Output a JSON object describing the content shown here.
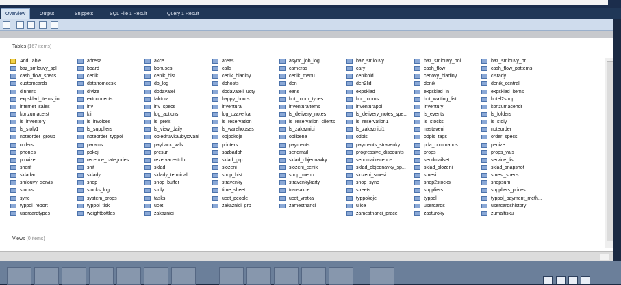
{
  "tabs": [
    {
      "label": "Overview",
      "active": true
    },
    {
      "label": "Output"
    },
    {
      "label": "Snippets"
    },
    {
      "label": "SQL File 1 Result"
    },
    {
      "label": "Query 1 Result"
    }
  ],
  "tables": {
    "title": "Tables",
    "count": "(167 items)",
    "add_label": "Add Table",
    "columns": [
      [
        "baz_smlouvy_spl",
        "cash_flow_specs",
        "customcards",
        "dinners",
        "expsklad_items_in",
        "internet_sales",
        "konzumacelst",
        "ls_inventory",
        "ls_stoly1",
        "noteorder_group",
        "orders",
        "phones",
        "provize",
        "sherif",
        "skladan",
        "smlouvy_servis",
        "stocks",
        "sync",
        "typpol_report",
        "usercardtypes"
      ],
      [
        "adresa",
        "board",
        "cenik",
        "datafromcesk",
        "divize",
        "extconnects",
        "inv",
        "kli",
        "ls_invoices",
        "ls_suppliers",
        "noteorder_typpol",
        "params",
        "pokoj",
        "recepce_categories",
        "shit",
        "sklady",
        "snop",
        "stocks_log",
        "system_props",
        "typpol_tisk",
        "weightbottles"
      ],
      [
        "akce",
        "bonuses",
        "cenik_hist",
        "db_log",
        "dodavatel",
        "faktura",
        "inv_specs",
        "log_actions",
        "ls_prefs",
        "ls_view_daily",
        "objednavkaubytovani",
        "payback_vals",
        "presun",
        "rezervacestolu",
        "sklad",
        "sklady_terminal",
        "snop_buffer",
        "stoly",
        "tasks",
        "ucet",
        "zakaznici"
      ],
      [
        "areas",
        "calls",
        "cenik_hladiny",
        "dbhosts",
        "dodavateli_ucty",
        "happy_hours",
        "inventura",
        "log_uzaverka",
        "ls_reservation",
        "ls_warehouses",
        "objpokoje",
        "printers",
        "sazbadph",
        "sklad_grp",
        "slozeni",
        "snop_hist",
        "stravenky",
        "time_sheet",
        "ucet_people",
        "zakaznici_grp"
      ],
      [
        "async_job_log",
        "cameras",
        "cenik_menu",
        "den",
        "eans",
        "hot_room_types",
        "inventuraitems",
        "ls_delivery_notes",
        "ls_reservation_clients",
        "ls_zakaznici",
        "oblibene",
        "payments",
        "sendmail",
        "sklad_objednavky",
        "slozeni_cenik",
        "snop_menu",
        "stravenkykarty",
        "transakce",
        "ucet_vratka",
        "zamestnanci"
      ],
      [
        "baz_smlouvy",
        "cary",
        "cenikold",
        "den2lidi",
        "expsklad",
        "hot_rooms",
        "inventurapol",
        "ls_delivery_notes_spe...",
        "ls_reservation1",
        "ls_zakaznici1",
        "odpis",
        "payments_stravenky",
        "progressive_discounts",
        "sendmailrecepce",
        "sklad_objednavky_sp...",
        "slozeni_smesi",
        "snop_sync",
        "streets",
        "typpokoje",
        "ulice",
        "zamestnanci_prace"
      ],
      [
        "baz_smlouvy_pol",
        "cash_flow",
        "cenovy_hladiny",
        "denik",
        "expsklad_in",
        "hot_waiting_list",
        "inventury",
        "ls_events",
        "ls_stocks",
        "nastaveni",
        "odpis_tags",
        "pda_commands",
        "props",
        "sendmailset",
        "sklad_slozeni",
        "smesi",
        "snop2stocks",
        "suppliers",
        "typpol",
        "usercards",
        "zasturoky"
      ],
      [
        "baz_smlouvy_pr",
        "cash_flow_patterns",
        "cisrady",
        "denik_central",
        "expsklad_items",
        "hotel2snop",
        "konzumacehdr",
        "ls_folders",
        "ls_stoly",
        "noteorder",
        "order_specs",
        "penize",
        "props_vals",
        "service_list",
        "sklad_snapshot",
        "smesi_specs",
        "snopsum",
        "suppliers_prices",
        "typpol_payment_meth...",
        "usercardshistory",
        "zumaltisku"
      ]
    ]
  },
  "views": {
    "title": "Views",
    "count": "(0 items)"
  },
  "icons": {
    "add": "add-table-icon",
    "table": "table-icon"
  }
}
